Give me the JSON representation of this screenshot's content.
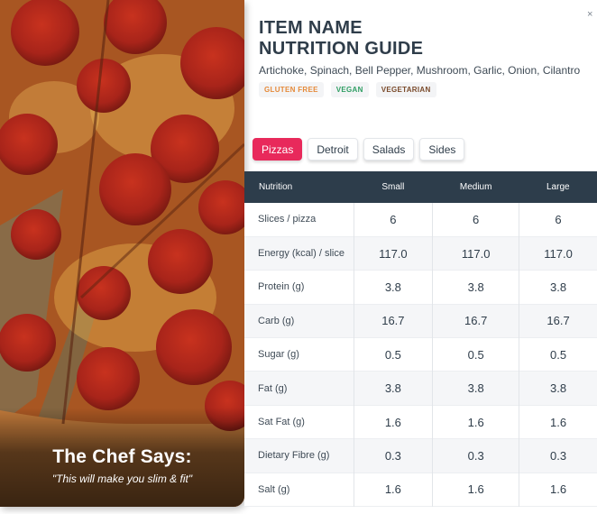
{
  "header": {
    "title_line1": "ITEM NAME",
    "title_line2": "NUTRITION GUIDE",
    "ingredients": "Artichoke, Spinach, Bell Pepper, Mushroom, Garlic, Onion, Cilantro",
    "close_glyph": "×"
  },
  "tags": [
    "GLUTEN FREE",
    "VEGAN",
    "VEGETARIAN"
  ],
  "tabs": [
    {
      "label": "Pizzas",
      "active": true
    },
    {
      "label": "Detroit",
      "active": false
    },
    {
      "label": "Salads",
      "active": false
    },
    {
      "label": "Sides",
      "active": false
    }
  ],
  "chef": {
    "title": "The Chef Says:",
    "quote": "\"This will make you slim & fit\""
  },
  "table": {
    "headers": [
      "Nutrition",
      "Small",
      "Medium",
      "Large"
    ],
    "rows": [
      {
        "name": "Slices / pizza",
        "small": "6",
        "medium": "6",
        "large": "6"
      },
      {
        "name": "Energy (kcal) / slice",
        "small": "117.0",
        "medium": "117.0",
        "large": "117.0"
      },
      {
        "name": "Protein (g)",
        "small": "3.8",
        "medium": "3.8",
        "large": "3.8"
      },
      {
        "name": "Carb (g)",
        "small": "16.7",
        "medium": "16.7",
        "large": "16.7"
      },
      {
        "name": "Sugar (g)",
        "small": "0.5",
        "medium": "0.5",
        "large": "0.5"
      },
      {
        "name": "Fat (g)",
        "small": "3.8",
        "medium": "3.8",
        "large": "3.8"
      },
      {
        "name": "Sat Fat (g)",
        "small": "1.6",
        "medium": "1.6",
        "large": "1.6"
      },
      {
        "name": "Dietary Fibre (g)",
        "small": "0.3",
        "medium": "0.3",
        "large": "0.3"
      },
      {
        "name": "Salt (g)",
        "small": "1.6",
        "medium": "1.6",
        "large": "1.6"
      }
    ]
  },
  "colors": {
    "accent": "#e8295b",
    "table_header": "#2d3d4b",
    "tag_gluten_free": "#e58a3a",
    "tag_vegan": "#2f9e63",
    "tag_vegetarian": "#7a4a2a"
  }
}
